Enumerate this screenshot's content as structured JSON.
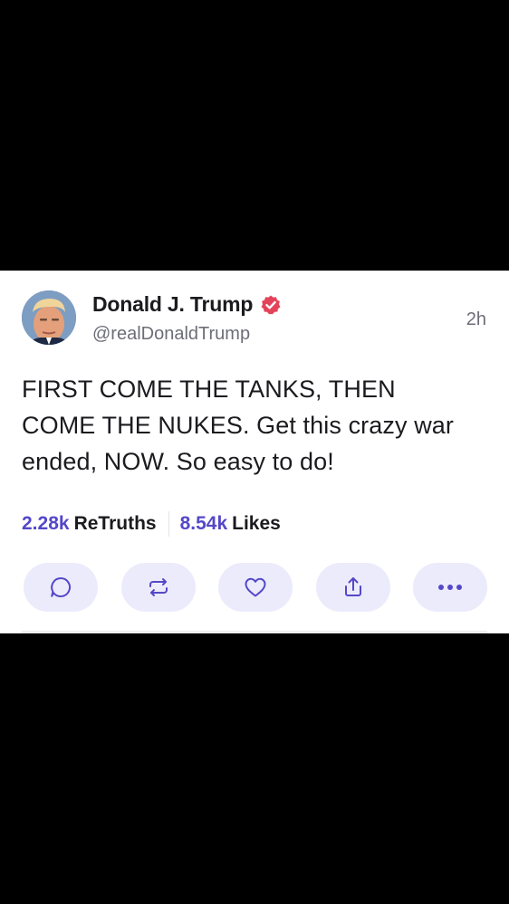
{
  "post": {
    "author": {
      "display_name": "Donald J. Trump",
      "handle": "@realDonaldTrump",
      "verified": true
    },
    "timestamp": "2h",
    "text": "FIRST COME THE TANKS, THEN COME THE NUKES. Get this crazy war ended, NOW. So easy to do!",
    "stats": {
      "retruths_count": "2.28k",
      "retruths_label": "ReTruths",
      "likes_count": "8.54k",
      "likes_label": "Likes"
    },
    "actions": [
      {
        "name": "reply",
        "icon": "comment-icon"
      },
      {
        "name": "retruth",
        "icon": "repost-icon"
      },
      {
        "name": "like",
        "icon": "heart-icon"
      },
      {
        "name": "share",
        "icon": "share-icon"
      },
      {
        "name": "more",
        "icon": "more-icon"
      }
    ]
  },
  "colors": {
    "accent": "#5448c8",
    "action_button_bg": "#ecebfb",
    "verified_badge": "#e3445a",
    "text_primary": "#1b1b1f",
    "text_secondary": "#6d6d78",
    "letterbox": "#000000"
  }
}
